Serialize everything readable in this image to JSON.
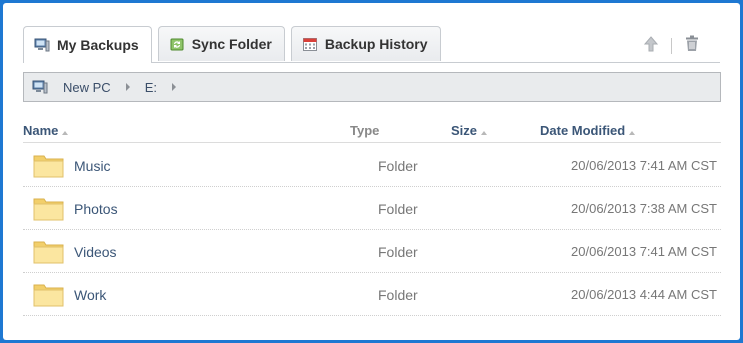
{
  "tabs": [
    {
      "label": "My Backups",
      "icon": "monitor-icon",
      "active": true
    },
    {
      "label": "Sync Folder",
      "icon": "sync-icon",
      "active": false
    },
    {
      "label": "Backup History",
      "icon": "calendar-icon",
      "active": false
    }
  ],
  "toolbar": {
    "up_icon": "arrow-up-icon",
    "delete_icon": "trash-icon"
  },
  "breadcrumb": {
    "icon": "monitor-icon",
    "items": [
      "New PC",
      "E:"
    ]
  },
  "table": {
    "columns": {
      "name": "Name",
      "type": "Type",
      "size": "Size",
      "date": "Date Modified"
    },
    "rows": [
      {
        "name": "Music",
        "type": "Folder",
        "date": "20/06/2013 7:41 AM CST"
      },
      {
        "name": "Photos",
        "type": "Folder",
        "date": "20/06/2013 7:38 AM CST"
      },
      {
        "name": "Videos",
        "type": "Folder",
        "date": "20/06/2013 7:41 AM CST"
      },
      {
        "name": "Work",
        "type": "Folder",
        "date": "20/06/2013 4:44 AM CST"
      }
    ]
  },
  "colors": {
    "frame": "#1e78d2",
    "link": "#3b5677",
    "folder": "#f7dc84"
  }
}
